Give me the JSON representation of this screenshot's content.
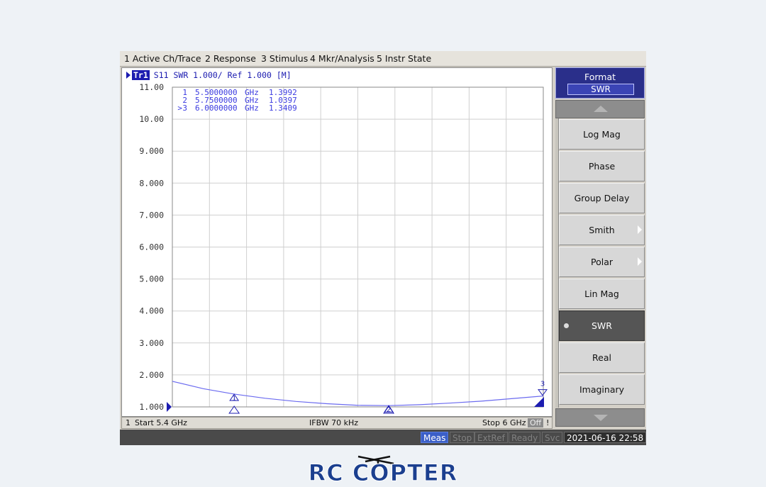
{
  "menu": [
    "1 Active Ch/Trace",
    "2 Response",
    "3 Stimulus",
    "4 Mkr/Analysis",
    "5 Instr State"
  ],
  "trace_header": {
    "badge": "Tr1",
    "text": "S11  SWR 1.000/ Ref 1.000 [M]"
  },
  "chart_data": {
    "type": "line",
    "x_unit": "GHz",
    "xlim": [
      5.4,
      6.0
    ],
    "ylim": [
      1.0,
      11.0
    ],
    "y_ticks": [
      "11.00",
      "10.00",
      "9.000",
      "8.000",
      "7.000",
      "6.000",
      "5.000",
      "4.000",
      "3.000",
      "2.000",
      "1.000"
    ],
    "grid": true,
    "series": [
      {
        "color": "#6b6bf0",
        "x": [
          5.4,
          5.45,
          5.5,
          5.55,
          5.6,
          5.65,
          5.7,
          5.75,
          5.8,
          5.85,
          5.9,
          5.95,
          6.0
        ],
        "y": [
          1.8,
          1.57,
          1.4,
          1.27,
          1.17,
          1.1,
          1.05,
          1.04,
          1.07,
          1.12,
          1.18,
          1.26,
          1.34
        ]
      }
    ],
    "markers": [
      {
        "id": "1",
        "prefix": "",
        "x": 5.5,
        "freq": "5.5000000",
        "unit": "GHz",
        "value": "1.3992",
        "y": 1.3992
      },
      {
        "id": "2",
        "prefix": "",
        "x": 5.75,
        "freq": "5.7500000",
        "unit": "GHz",
        "value": "1.0397",
        "y": 1.0397
      },
      {
        "id": "3",
        "prefix": ">",
        "x": 6.0,
        "freq": "6.0000000",
        "unit": "GHz",
        "value": "1.3409",
        "y": 1.3409
      }
    ]
  },
  "status": {
    "channel": "1",
    "start": "Start 5.4 GHz",
    "ifbw": "IFBW 70 kHz",
    "stop": "Stop 6 GHz",
    "off": "Off",
    "excl": "!"
  },
  "bottom_bar": {
    "items": [
      "Meas",
      "Stop",
      "ExtRef",
      "Ready",
      "Svc"
    ],
    "datetime": "2021-06-16 22:58"
  },
  "softkeys": {
    "title": "Format",
    "value": "SWR",
    "buttons": [
      {
        "label": "Log Mag"
      },
      {
        "label": "Phase"
      },
      {
        "label": "Group Delay"
      },
      {
        "label": "Smith",
        "submenu": true
      },
      {
        "label": "Polar",
        "submenu": true
      },
      {
        "label": "Lin Mag"
      },
      {
        "label": "SWR",
        "selected": true
      },
      {
        "label": "Real"
      },
      {
        "label": "Imaginary"
      }
    ]
  },
  "logo": {
    "text": "RC COPTER"
  }
}
